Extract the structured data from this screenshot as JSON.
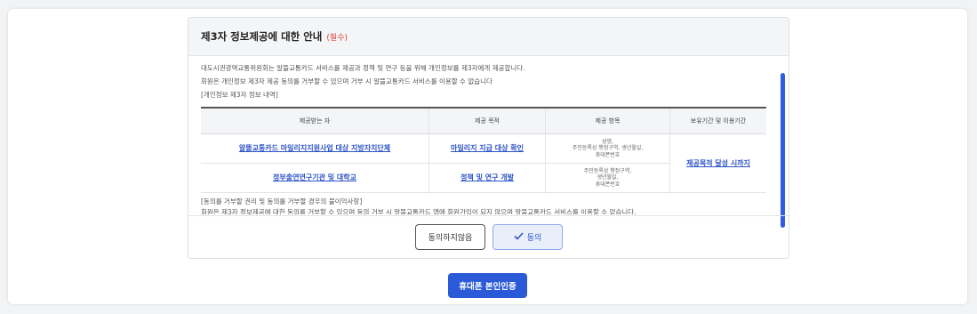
{
  "consent": {
    "title": "제3자 정보제공에 대한 안내",
    "required_label": "(필수)",
    "intro_line1": "대도시권광역교통위원회는 알뜰교통카드 서비스를 제공과 정책 및 연구 등을 위해 개인정보를 제3자에게 제공합니다.",
    "intro_line2": "회원은 개인정보 제3자 제공 동의를 거부할 수 있으며 거부 시 알뜰교통카드 서비스를 이용할 수 없습니다",
    "section_label": "[개인정보 제3자 정보 내역]",
    "table": {
      "headers": [
        "제공받는 자",
        "제공 목적",
        "제공 항목",
        "보유기간 및 이용기간"
      ],
      "rows": [
        {
          "recipient": "알뜰교통카드 마일리지지원사업 대상 지방자치단체",
          "purpose": "마일리지 지급 대상 확인",
          "items": [
            "성명,",
            "주민등록상 행정구역, 생년월일,",
            "휴대폰번호"
          ]
        },
        {
          "recipient": "정부출연연구기관 및 대학교",
          "purpose": "정책 및 연구 개발",
          "items": [
            "주민등록상 행정구역,",
            "생년월일,",
            "휴대폰번호"
          ]
        }
      ],
      "retention": "제공목적 달성 시까지"
    },
    "refusal_title": "[동의를 거부할 권리 및 동의를 거부할 경우의 불이익사항]",
    "refusal_text": "회원은 제3자 정보제공에 대한 동의를 거부할 수 있으며 동의 거부 시 알뜰교통카드 앱에 회원가입이 되지 않으며 알뜰교통카드 서비스를 이용할 수 없습니다."
  },
  "buttons": {
    "disagree": "동의하지않음",
    "agree": "동의",
    "verify": "휴대폰 본인인증"
  },
  "icons": {
    "agree": "checkmark-icon"
  },
  "colors": {
    "accent": "#2a5ad7",
    "required": "#e0413a",
    "link": "#2e55c8"
  }
}
